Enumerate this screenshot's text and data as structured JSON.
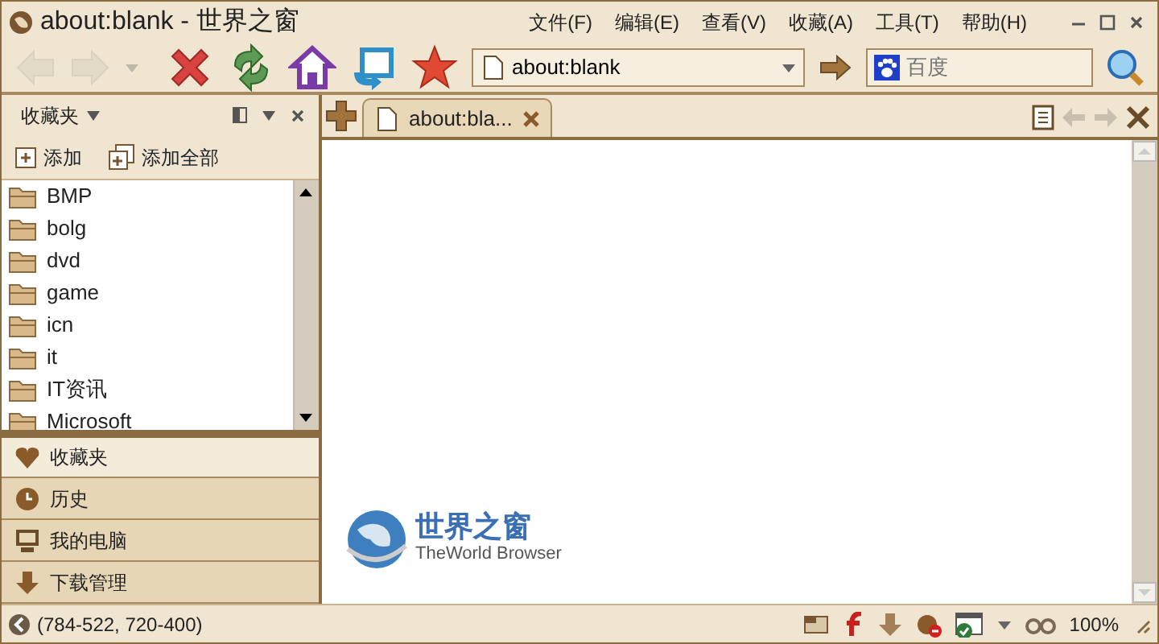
{
  "window": {
    "title": "about:blank - 世界之窗"
  },
  "menu": [
    "文件(F)",
    "编辑(E)",
    "查看(V)",
    "收藏(A)",
    "工具(T)",
    "帮助(H)"
  ],
  "nav_buttons": [
    {
      "kind": "back",
      "disabled": true
    },
    {
      "kind": "forward",
      "disabled": true
    }
  ],
  "address": {
    "value": "about:blank"
  },
  "search": {
    "placeholder": "百度"
  },
  "sidebar": {
    "title": "收藏夹",
    "actions": [
      "添加",
      "添加全部"
    ],
    "items": [
      "BMP",
      "bolg",
      "dvd",
      "game",
      "icn",
      "it",
      "IT资讯",
      "Microsoft"
    ],
    "panels": [
      {
        "kind": "favorites",
        "label": "收藏夹",
        "selected": true
      },
      {
        "kind": "history",
        "label": "历史",
        "selected": false
      },
      {
        "kind": "computer",
        "label": "我的电脑",
        "selected": false
      },
      {
        "kind": "downloads",
        "label": "下载管理",
        "selected": false
      }
    ]
  },
  "tabs": [
    {
      "label": "about:bla...",
      "selected": true
    }
  ],
  "logo": {
    "name": "世界之窗",
    "subtitle": "TheWorld Browser"
  },
  "status_bar": {
    "text": "(784-522, 720-400)",
    "zoom": "100%"
  }
}
